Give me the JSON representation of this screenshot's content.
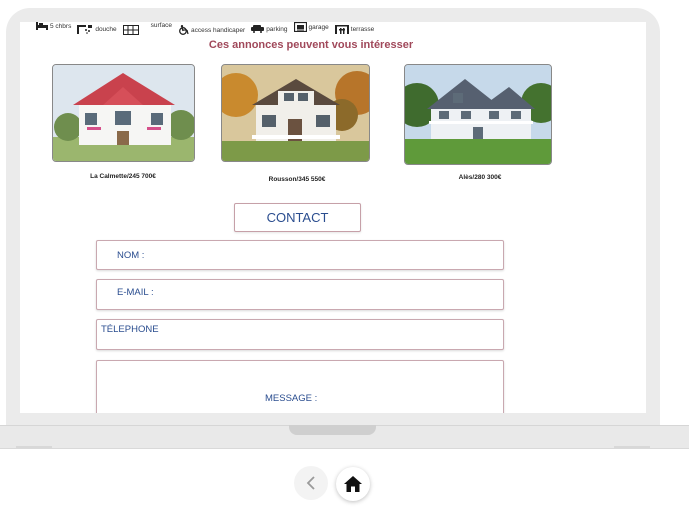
{
  "amenities": [
    {
      "icon": "bed-icon",
      "label": "5 chbrs"
    },
    {
      "icon": "shower-icon",
      "label": "douche"
    },
    {
      "icon": "floor-plan-icon",
      "label": "surface"
    },
    {
      "icon": "wheelchair-icon",
      "label": "access handicaper"
    },
    {
      "icon": "car-icon",
      "label": "parking"
    },
    {
      "icon": "garage-icon",
      "label": "garage"
    },
    {
      "icon": "terrace-icon",
      "label": "terrasse"
    }
  ],
  "suggestions": {
    "title": "Ces annonces peuvent vous intéresser",
    "listings": [
      {
        "caption": "La Calmette/245 700€"
      },
      {
        "caption": "Rousson/345 550€"
      },
      {
        "caption": "Alès/280 300€"
      }
    ]
  },
  "contact": {
    "button_label": "CONTACT",
    "name_label": "NOM :",
    "email_label": "E-MAIL :",
    "phone_label": "TÉLEPHONE",
    "message_label": "MESSAGE :"
  },
  "colors": {
    "title": "#a0485a",
    "label": "#2a4d8f",
    "field_border": "#c9a8b0"
  }
}
